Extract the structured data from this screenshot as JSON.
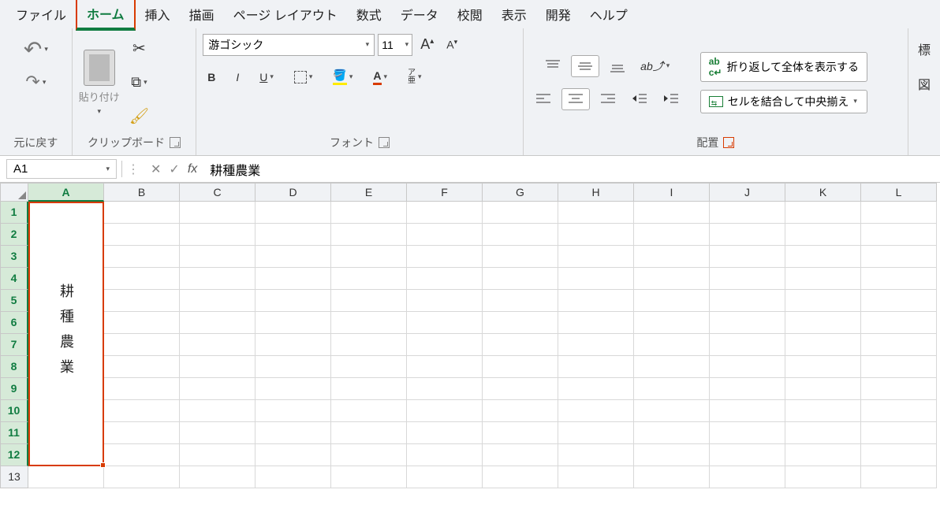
{
  "menu": [
    "ファイル",
    "ホーム",
    "挿入",
    "描画",
    "ページ レイアウト",
    "数式",
    "データ",
    "校閲",
    "表示",
    "開発",
    "ヘルプ"
  ],
  "menu_active_index": 1,
  "ribbon": {
    "undo_label": "元に戻す",
    "clipboard_label": "クリップボード",
    "paste_label": "貼り付け",
    "font_group_label": "フォント",
    "font_name": "游ゴシック",
    "font_size": "11",
    "bold": "B",
    "italic": "I",
    "underline": "U",
    "phonetic": "ア\n亜",
    "align_group_label": "配置",
    "wrap_text_label": "折り返して全体を表示する",
    "merge_center_label": "セルを結合して中央揃え",
    "styles_stub1": "標",
    "styles_stub2": "図"
  },
  "formula": {
    "cell_ref": "A1",
    "value": "耕種農業"
  },
  "grid": {
    "columns": [
      "A",
      "B",
      "C",
      "D",
      "E",
      "F",
      "G",
      "H",
      "I",
      "J",
      "K",
      "L"
    ],
    "rows": [
      "1",
      "2",
      "3",
      "4",
      "5",
      "6",
      "7",
      "8",
      "9",
      "10",
      "11",
      "12",
      "13"
    ],
    "merged_text": "耕種農業"
  }
}
